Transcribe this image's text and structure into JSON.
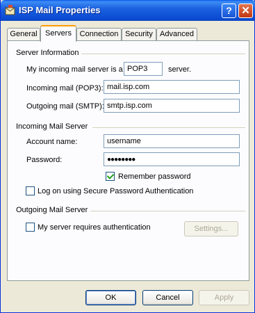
{
  "window": {
    "title": "ISP Mail Properties"
  },
  "title_buttons": {
    "help": "?",
    "close": "✕"
  },
  "tabs": [
    {
      "label": "General",
      "active": false
    },
    {
      "label": "Servers",
      "active": true
    },
    {
      "label": "Connection",
      "active": false
    },
    {
      "label": "Security",
      "active": false
    },
    {
      "label": "Advanced",
      "active": false
    }
  ],
  "server_info": {
    "group_label": "Server Information",
    "incoming_type_prefix": "My incoming mail server is a",
    "incoming_type_value": "POP3",
    "incoming_type_suffix": "server.",
    "incoming_label": "Incoming mail (POP3):",
    "incoming_value": "mail.isp.com",
    "outgoing_label": "Outgoing mail (SMTP):",
    "outgoing_value": "smtp.isp.com"
  },
  "incoming_server": {
    "group_label": "Incoming Mail Server",
    "account_label": "Account name:",
    "account_value": "username",
    "password_label": "Password:",
    "password_value": "●●●●●●●●",
    "remember_label": "Remember password",
    "remember_checked": true,
    "spa_label": "Log on using Secure Password Authentication",
    "spa_checked": false
  },
  "outgoing_server": {
    "group_label": "Outgoing Mail Server",
    "auth_label": "My server requires authentication",
    "auth_checked": false,
    "settings_label": "Settings..."
  },
  "buttons": {
    "ok": "OK",
    "cancel": "Cancel",
    "apply": "Apply"
  }
}
